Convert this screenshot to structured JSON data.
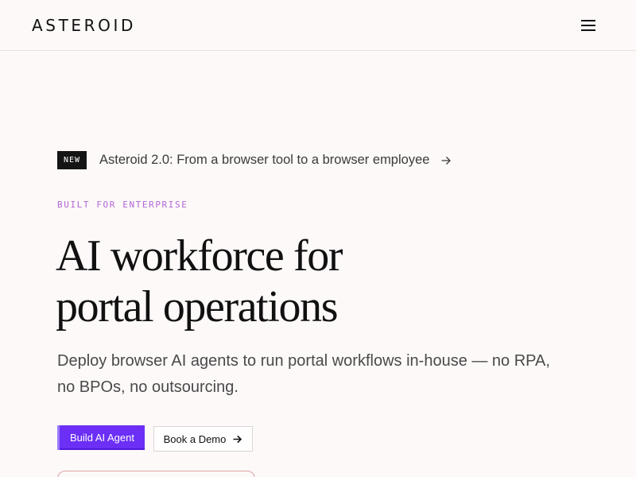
{
  "header": {
    "logo_text": "ASTEROID",
    "menu_icon": "hamburger-menu-icon"
  },
  "announcement": {
    "badge": "NEW",
    "text": "Asteroid 2.0: From a browser tool to a browser employee",
    "arrow_icon": "arrow-right-icon"
  },
  "hero": {
    "eyebrow": "BUILT FOR ENTERPRISE",
    "headline_line1": "AI workforce for",
    "headline_line2": "portal operations",
    "subtext_line1": "Deploy browser AI agents to run portal workflows in-house — no RPA,",
    "subtext_line2": "no BPOs, no outsourcing."
  },
  "actions": {
    "primary_label": "Build AI Agent",
    "secondary_label": "Book a Demo",
    "secondary_icon": "arrow-right-icon"
  },
  "colors": {
    "background": "#fcf9f8",
    "accent": "#6b2ff5",
    "eyebrow": "#b466d8",
    "text": "#111111"
  }
}
